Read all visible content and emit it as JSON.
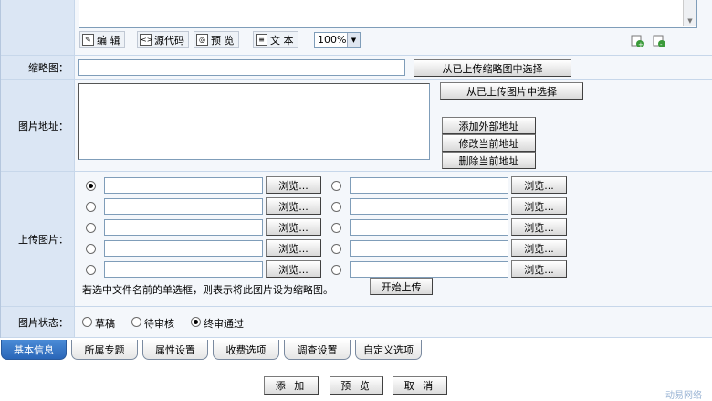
{
  "editor": {
    "toolbar": {
      "edit_label": "编 辑",
      "source_label": "源代码",
      "preview_label": "预 览",
      "text_label": "文 本",
      "zoom_value": "100%"
    }
  },
  "thumbnail": {
    "label": "缩略图：",
    "select_button": "从已上传缩略图中选择"
  },
  "image_url": {
    "label": "图片地址：",
    "select_button": "从已上传图片中选择",
    "add_button": "添加外部地址",
    "modify_button": "修改当前地址",
    "delete_button": "删除当前地址"
  },
  "upload": {
    "label": "上传图片：",
    "browse_label": "浏览...",
    "hint": "若选中文件名前的单选框，则表示将此图片设为缩略图。",
    "start_button": "开始上传"
  },
  "status": {
    "label": "图片状态：",
    "options": [
      "草稿",
      "待审核",
      "终审通过"
    ],
    "selected": "终审通过"
  },
  "tabs": [
    "基本信息",
    "所属专题",
    "属性设置",
    "收费选项",
    "调查设置",
    "自定义选项"
  ],
  "actions": {
    "add": "添 加",
    "preview": "预 览",
    "cancel": "取 消"
  },
  "watermark": "动易网络"
}
